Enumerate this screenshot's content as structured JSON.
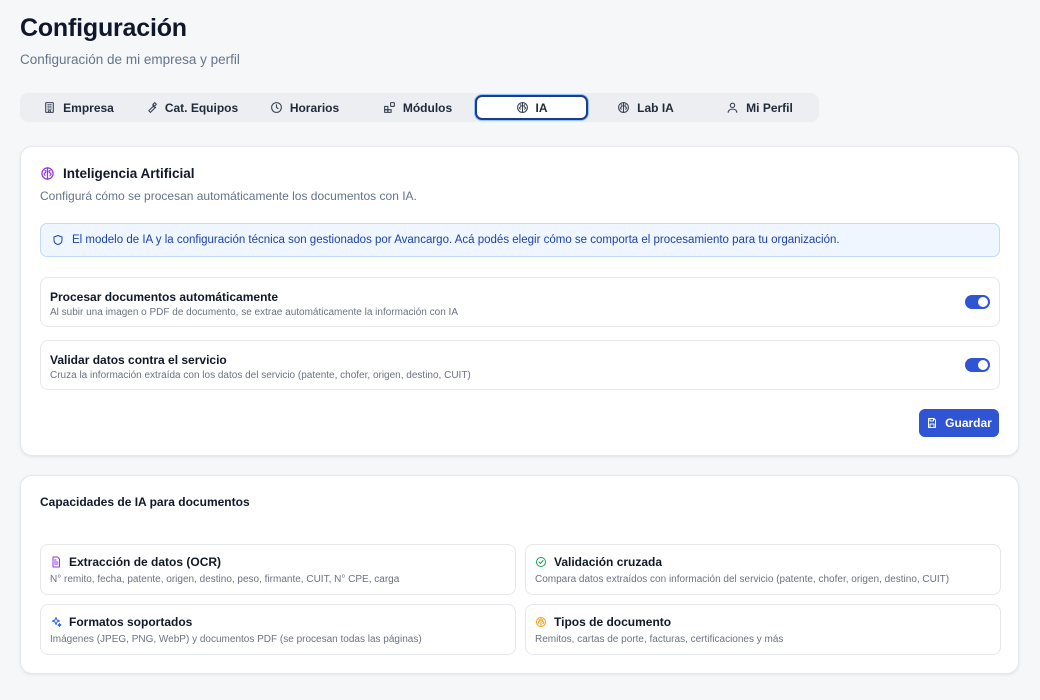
{
  "page": {
    "title": "Configuración",
    "subtitle": "Configuración de mi empresa y perfil"
  },
  "tabs": [
    {
      "label": "Empresa",
      "icon": "building-icon"
    },
    {
      "label": "Cat. Equipos",
      "icon": "wrench-icon"
    },
    {
      "label": "Horarios",
      "icon": "clock-icon"
    },
    {
      "label": "Módulos",
      "icon": "blocks-icon"
    },
    {
      "label": "IA",
      "icon": "brain-icon",
      "active": true
    },
    {
      "label": "Lab IA",
      "icon": "brain-icon"
    },
    {
      "label": "Mi Perfil",
      "icon": "user-icon"
    }
  ],
  "ai_settings": {
    "title": "Inteligencia Artificial",
    "description": "Configurá cómo se procesan automáticamente los documentos con IA.",
    "info": "El modelo de IA y la configuración técnica son gestionados por Avancargo. Acá podés elegir cómo se comporta el procesamiento para tu organización.",
    "settings": [
      {
        "title": "Procesar documentos automáticamente",
        "description": "Al subir una imagen o PDF de documento, se extrae automáticamente la información con IA",
        "enabled": true
      },
      {
        "title": "Validar datos contra el servicio",
        "description": "Cruza la información extraída con los datos del servicio (patente, chofer, origen, destino, CUIT)",
        "enabled": true
      }
    ],
    "save_label": "Guardar"
  },
  "capabilities": {
    "title": "Capacidades de IA para documentos",
    "items": [
      {
        "title": "Extracción de datos (OCR)",
        "description": "N° remito, fecha, patente, origen, destino, peso, firmante, CUIT, N° CPE, carga",
        "icon": "file-text-icon",
        "color": "#9333ea"
      },
      {
        "title": "Validación cruzada",
        "description": "Compara datos extraídos con información del servicio (patente, chofer, origen, destino, CUIT)",
        "icon": "check-circle-icon",
        "color": "#16a34a"
      },
      {
        "title": "Formatos soportados",
        "description": "Imágenes (JPEG, PNG, WebP) y documentos PDF (se procesan todas las páginas)",
        "icon": "sparkles-icon",
        "color": "#2563eb"
      },
      {
        "title": "Tipos de documento",
        "description": "Remitos, cartas de porte, facturas, certificaciones y más",
        "icon": "brain-icon",
        "color": "#f59e0b"
      }
    ]
  },
  "colors": {
    "accent": "#2f55d4",
    "info_bg": "#eff6ff",
    "info_text": "#1e40af"
  }
}
